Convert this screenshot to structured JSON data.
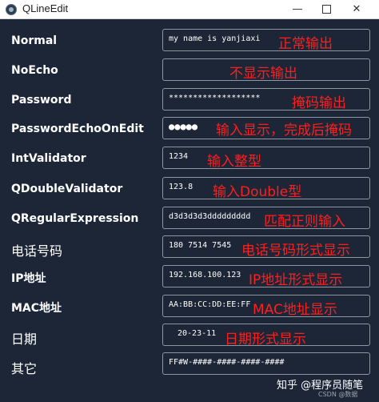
{
  "window": {
    "title": "QLineEdit",
    "minimize": "—",
    "close": "✕"
  },
  "rows": [
    {
      "label": "Normal",
      "value": "my name is yanjiaxi",
      "note": "正常输出"
    },
    {
      "label": "NoEcho",
      "value": "",
      "note": "不显示输出"
    },
    {
      "label": "Password",
      "value": "*******************",
      "note": "掩码输出"
    },
    {
      "label": "PasswordEchoOnEdit",
      "value": "●●●●●",
      "note": "输入显示，完成后掩码"
    },
    {
      "label": "IntValidator",
      "value": "1234",
      "note": "输入整型"
    },
    {
      "label": "QDoubleValidator",
      "value": "123.8",
      "note": "输入Double型"
    },
    {
      "label": "QRegularExpression",
      "value": "d3d3d3d3ddddddddd",
      "note": "匹配正则输入"
    },
    {
      "label": "电话号码",
      "value": "180 7514 7545",
      "note": "电话号码形式显示"
    },
    {
      "label": "IP地址",
      "value": "192.168.100.123",
      "note": "IP地址形式显示"
    },
    {
      "label": "MAC地址",
      "value": "AA:BB:CC:DD:EE:FF",
      "note": "MAC地址显示"
    },
    {
      "label": "日期",
      "value": "20-23-11",
      "note": "日期形式显示"
    },
    {
      "label": "其它",
      "value": "FF#W-####-####-####-####",
      "note": ""
    }
  ],
  "watermark": {
    "text": "知乎 @程序员随笔",
    "sub": "CSDN @数据"
  },
  "colors": {
    "background": "#1c2636",
    "field_border": "#8e979f",
    "annotation": "#ff1f1f"
  }
}
